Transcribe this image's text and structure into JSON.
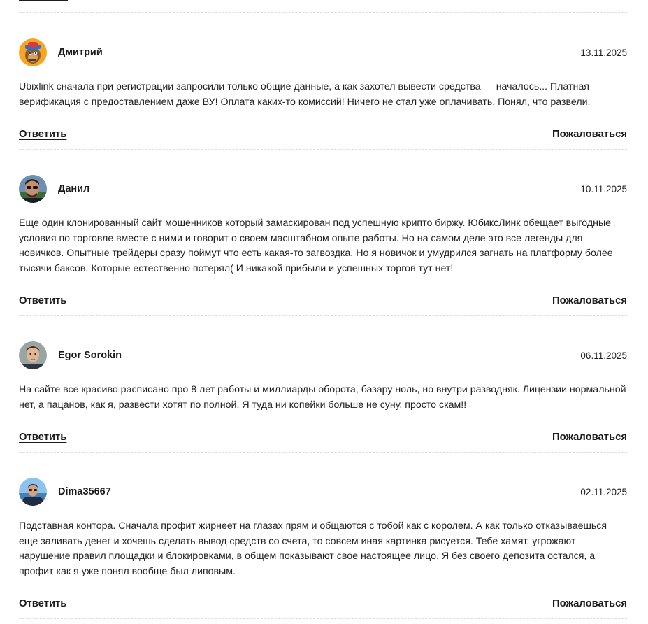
{
  "reviews": [
    {
      "author": "Дмитрий",
      "date": "13.11.2025",
      "avatar_icon": "cartoon-ape-avatar",
      "text": "Ubixlink сначала при регистрации запросили только общие данные, а как захотел вывести средства — началось... Платная верификация с предоставлением даже ВУ! Оплата каких-то комиссий! Ничего не стал уже оплачивать. Понял, что развели.",
      "reply_label": "Ответить",
      "report_label": "Пожаловаться"
    },
    {
      "author": "Данил",
      "date": "10.11.2025",
      "avatar_icon": "man-sunglasses-photo-avatar",
      "text": "Еще один клонированный сайт мошенников который замаскирован под успешную крипто биржу. ЮбиксЛинк обещает выгодные условия по торговле вместе с ними и говорит о своем масштабном опыте работы. Но на самом деле это все легенды для новичков. Опытные трейдеры сразу поймут что есть какая-то загвоздка. Но я новичок и умудрился загнать на платформу более тысячи баксов. Которые естественно потерял( И никакой прибыли и успешных торгов тут нет!",
      "reply_label": "Ответить",
      "report_label": "Пожаловаться"
    },
    {
      "author": "Egor Sorokin",
      "date": "06.11.2025",
      "avatar_icon": "young-man-photo-avatar",
      "text": "На сайте все красиво расписано про 8 лет работы и миллиарды оборота, базару ноль, но внутри разводняк. Лицензии нормальной нет, а пацанов, как я, развести хотят по полной. Я туда ни копейки больше не суну, просто скам!!",
      "reply_label": "Ответить",
      "report_label": "Пожаловаться"
    },
    {
      "author": "Dima35667",
      "date": "02.11.2025",
      "avatar_icon": "man-outdoors-photo-avatar",
      "text": "Подставная контора. Сначала профит жирнеет на глазах прям и общаются с тобой как с королем. А как только отказываешься еще заливать денег и хочешь сделать вывод средств со счета, то совсем иная картинка рисуется. Тебе хамят, угрожают нарушение правил площадки и блокировками, в общем показывают свое настоящее лицо. Я без своего депозита остался, а профит как я уже понял вообще был липовым.",
      "reply_label": "Ответить",
      "report_label": "Пожаловаться"
    }
  ]
}
